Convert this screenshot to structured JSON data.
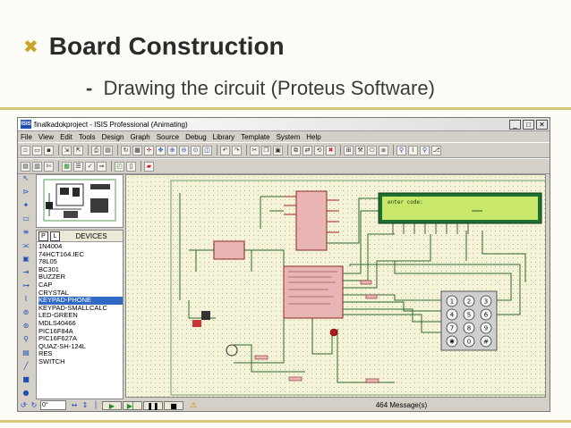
{
  "slide": {
    "bullet": "✖",
    "title": "Board Construction",
    "dash": "-",
    "subtitle": "Drawing the circuit (Proteus Software)"
  },
  "window": {
    "app_icon_text": "ISIS",
    "title": "finalkadokproject - ISIS Professional (Animating)",
    "controls": {
      "minimize": "_",
      "maximize": "□",
      "close": "✕"
    }
  },
  "menu": [
    "File",
    "View",
    "Edit",
    "Tools",
    "Design",
    "Graph",
    "Source",
    "Debug",
    "Library",
    "Template",
    "System",
    "Help"
  ],
  "devices": {
    "header_p": "P",
    "header_l": "L",
    "title": "DEVICES",
    "items": [
      "1N4004",
      "74HCT164.IEC",
      "78L05",
      "BC301",
      "BUZZER",
      "CAP",
      "CRYSTAL",
      "KEYPAD-PHONE",
      "KEYPAD-SMALLCALC",
      "LED-GREEN",
      "MDLS40466",
      "PIC16F84A",
      "PIC16F627A",
      "QUAZ-SH-124L",
      "RES",
      "SWITCH"
    ],
    "selected_index": 7
  },
  "schematic": {
    "lcd_text": "enter code:",
    "lcd_text2": "====",
    "lcd_color": "#c9e86a"
  },
  "keypad": {
    "keys": [
      "1",
      "2",
      "3",
      "4",
      "5",
      "6",
      "7",
      "8",
      "9",
      "✱",
      "0",
      "#"
    ]
  },
  "status": {
    "rotation": "0°",
    "message": "464 Message(s)"
  }
}
